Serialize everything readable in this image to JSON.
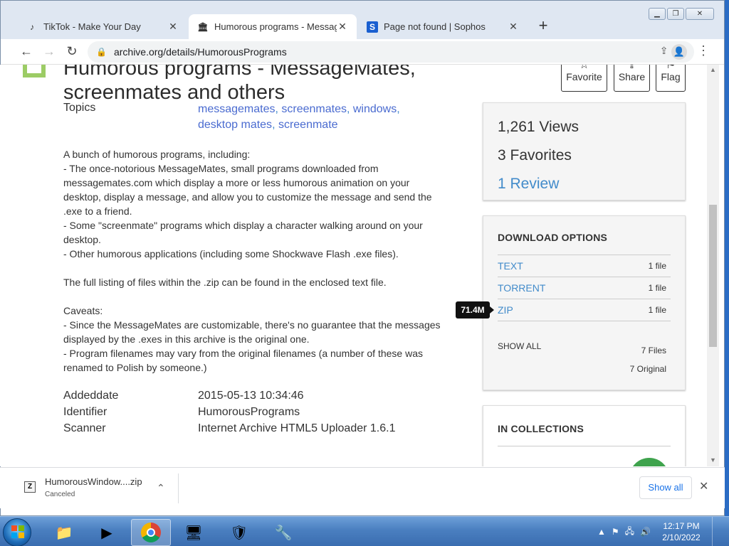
{
  "browser": {
    "tabs": [
      {
        "title": "TikTok - Make Your Day",
        "icon": "tiktok-icon"
      },
      {
        "title": "Humorous programs - MessageM",
        "icon": "archive-icon"
      },
      {
        "title": "Page not found | Sophos",
        "icon": "sophos-icon"
      }
    ],
    "active_tab": 1,
    "url": "archive.org/details/HumorousPrograms"
  },
  "item": {
    "title": "Humorous programs - MessageMates, screenmates and others",
    "actions": [
      {
        "label": "Favorite",
        "icon": "star-icon"
      },
      {
        "label": "Share",
        "icon": "share-icon"
      },
      {
        "label": "Flag",
        "icon": "flag-icon"
      }
    ],
    "topics_label": "Topics",
    "topics": [
      "messagemates",
      "screenmates",
      "windows",
      "desktop mates",
      "screenmate"
    ],
    "description": [
      "A bunch of humorous programs, including:",
      "- The once-notorious MessageMates, small programs downloaded from messagemates.com which display a more or less humorous animation on your desktop, display a message, and allow you to customize the message and send the .exe to a friend.",
      "- Some \"screenmate\" programs which display a character walking around on your desktop.",
      "- Other humorous applications (including some Shockwave Flash .exe files).",
      "",
      "The full listing of files within the .zip can be found in the enclosed text file.",
      "",
      "Caveats:",
      "- Since the MessageMates are customizable, there's no guarantee that the messages displayed by the .exes in this archive is the original one.",
      "- Program filenames may vary from the original filenames (a number of these was renamed to Polish by someone.)"
    ],
    "metadata": [
      {
        "label": "Addeddate",
        "value": "2015-05-13 10:34:46"
      },
      {
        "label": "Identifier",
        "value": "HumorousPrograms"
      },
      {
        "label": "Scanner",
        "value": "Internet Archive HTML5 Uploader 1.6.1"
      }
    ]
  },
  "stats": {
    "views": "1,261 Views",
    "favorites": "3 Favorites",
    "reviews": "1 Review"
  },
  "downloads": {
    "heading": "DOWNLOAD OPTIONS",
    "options": [
      {
        "name": "TEXT",
        "count": "1 file"
      },
      {
        "name": "TORRENT",
        "count": "1 file"
      },
      {
        "name": "ZIP",
        "count": "1 file"
      }
    ],
    "show_all": "SHOW ALL",
    "files": "7 Files",
    "original": "7 Original",
    "tooltip": "71.4M"
  },
  "collections": {
    "heading": "IN COLLECTIONS"
  },
  "shelf": {
    "file_name": "HumorousWindow....zip",
    "status": "Canceled",
    "show_all": "Show all"
  },
  "taskbar": {
    "time": "12:17 PM",
    "date": "2/10/2022"
  }
}
